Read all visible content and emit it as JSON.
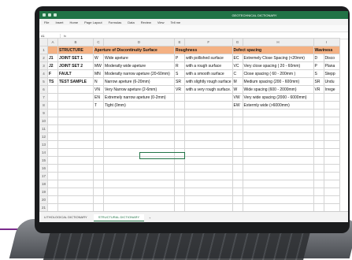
{
  "window": {
    "title": "GEOTECHNICAL DICTIONARY",
    "menu": [
      "File",
      "Insert",
      "Home",
      "Page Layout",
      "Formulas",
      "Data",
      "Review",
      "View",
      "Tell me"
    ]
  },
  "formula_bar": {
    "cell": "A1",
    "fx": "fx"
  },
  "columns": [
    "A",
    "B",
    "C",
    "D",
    "E",
    "F",
    "G",
    "H",
    "I"
  ],
  "header_row": [
    "",
    "STRUCTURE",
    "Aperture of Discontinuity Surface",
    "",
    "Roughness",
    "",
    "Defect spacing",
    "",
    "Waviness"
  ],
  "rows": [
    [
      "J1",
      "JOINT SET 1",
      "W",
      "Wide apeture",
      "P",
      "with pollished surface",
      "EC",
      "Extremely Close Spacing (<20mm)",
      "D",
      "Disco"
    ],
    [
      "J2",
      "JOINT SET 2",
      "MW",
      "Moderatly wide apeture",
      "R",
      "with a rough surface",
      "VC",
      "Very close spacing  ( 20 - 60mm)",
      "P",
      "Plana"
    ],
    [
      "F",
      "FAULT",
      "MN",
      "Moderatly narrow apeture (20-60mm)",
      "S",
      "with a smooth surface",
      "C",
      "Close spacing ( 60 - 200mm )",
      "S",
      "Stepp"
    ],
    [
      "TS",
      "TEST SAMPLE",
      "N",
      "Narrow apeture (6-20mm)",
      "SR",
      "with slightly rough surface",
      "M",
      "Medium spacing (200 - 600mm)",
      "SR",
      "Undu"
    ],
    [
      "",
      "",
      "VN",
      "Very Narrow apeture (2-6mm)",
      "VR",
      "with a very rough surface.",
      "W",
      "Wide spacing (600 - 2000mm)",
      "VR",
      "Irrege"
    ],
    [
      "",
      "",
      "EN",
      "Extremely narrow apeture (0-2mm)",
      "",
      "",
      "VW",
      "Very wide spacing (2000 - 6000mm)",
      "",
      ""
    ],
    [
      "",
      "",
      "T",
      "Tight (0mm)",
      "",
      "",
      "EW",
      "Extermly wide (>6000mm)",
      "",
      ""
    ]
  ],
  "empty_row_count": 16,
  "sheet_tabs": [
    "LITHOLOGICAL DICTIONARY",
    "STRUCTURAL DICTIONARY"
  ],
  "active_tab": 1,
  "colors": {
    "accent": "#217346",
    "header_fill": "#f4b183"
  }
}
